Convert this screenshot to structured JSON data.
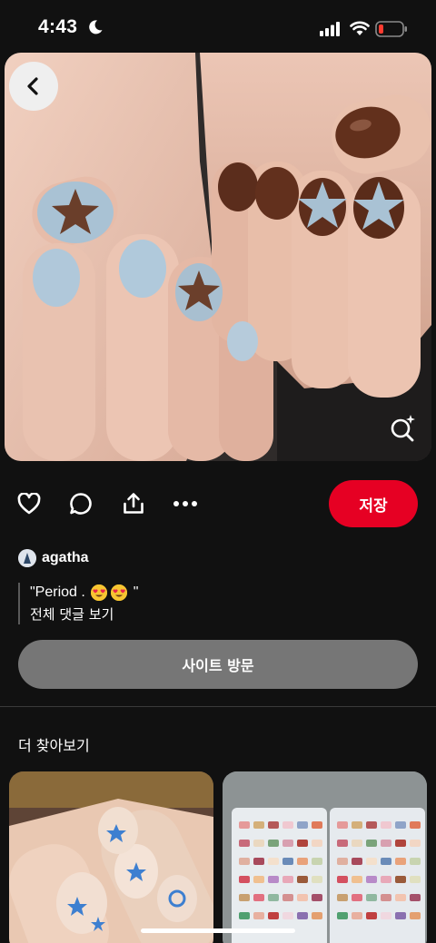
{
  "status_bar": {
    "time": "4:43"
  },
  "pin": {
    "author": "agatha",
    "description": "\"Period . 😍😍 \"",
    "description_parts": [
      "\"Period .",
      "\""
    ],
    "comments_link": "전체 댓글 보기"
  },
  "actions": {
    "save_label": "저장",
    "icons": [
      "heart-icon",
      "comment-icon",
      "share-icon",
      "more-icon"
    ]
  },
  "visit_button": "사이트 방문",
  "more_section": {
    "title": "더 찾아보기"
  },
  "colors": {
    "accent": "#e60023",
    "background": "#111111",
    "visit_button": "#767676"
  }
}
